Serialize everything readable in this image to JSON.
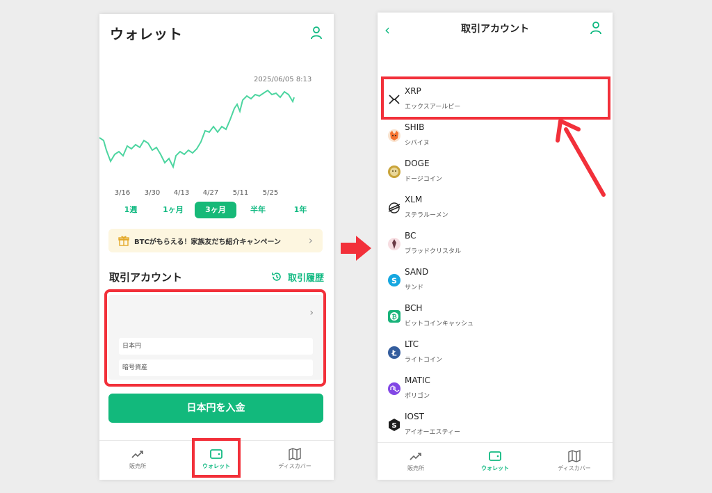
{
  "left": {
    "title": "ウォレット",
    "timestamp": "2025/06/05 8:13",
    "chart_data": {
      "type": "line",
      "x_ticks": [
        "3/16",
        "3/30",
        "4/13",
        "4/27",
        "5/11",
        "5/25"
      ],
      "color": "#4dd5a0"
    },
    "periods": [
      {
        "label": "1週",
        "active": false
      },
      {
        "label": "1ヶ月",
        "active": false
      },
      {
        "label": "3ヶ月",
        "active": true
      },
      {
        "label": "半年",
        "active": false
      },
      {
        "label": "1年",
        "active": false
      }
    ],
    "banner": "BTCがもらえる！家族友だち紹介キャンペーン",
    "section_title": "取引アカウント",
    "history_label": "取引履歴",
    "account_rows": [
      "日本円",
      "暗号資産"
    ],
    "deposit_label": "日本円を入金"
  },
  "tabs": [
    {
      "label": "販売所",
      "icon": "trend-icon"
    },
    {
      "label": "ウォレット",
      "icon": "wallet-icon"
    },
    {
      "label": "ディスカバー",
      "icon": "map-icon"
    }
  ],
  "right": {
    "title": "取引アカウント",
    "coins": [
      {
        "symbol": "XRP",
        "name": "エックスアールピー",
        "icon": "xrp-icon",
        "color": "#222222"
      },
      {
        "symbol": "SHIB",
        "name": "シバイヌ",
        "icon": "shib-icon",
        "color": "#f5722f"
      },
      {
        "symbol": "DOGE",
        "name": "ドージコイン",
        "icon": "doge-icon",
        "color": "#c9a43a"
      },
      {
        "symbol": "XLM",
        "name": "ステラルーメン",
        "icon": "xlm-icon",
        "color": "#222222"
      },
      {
        "symbol": "BC",
        "name": "ブラッドクリスタル",
        "icon": "bc-icon",
        "color": "#e9b5bd"
      },
      {
        "symbol": "SAND",
        "name": "サンド",
        "icon": "sand-icon",
        "color": "#16a7e0"
      },
      {
        "symbol": "BCH",
        "name": "ビットコインキャッシュ",
        "icon": "bch-icon",
        "color": "#19b37a"
      },
      {
        "symbol": "LTC",
        "name": "ライトコイン",
        "icon": "ltc-icon",
        "color": "#345d9d"
      },
      {
        "symbol": "MATIC",
        "name": "ポリゴン",
        "icon": "matic-icon",
        "color": "#8247e5"
      },
      {
        "symbol": "IOST",
        "name": "アイオーエスティー",
        "icon": "iost-icon",
        "color": "#1c1c1c"
      }
    ]
  },
  "colors": {
    "accent": "#10b981",
    "highlight": "#f2303a"
  }
}
